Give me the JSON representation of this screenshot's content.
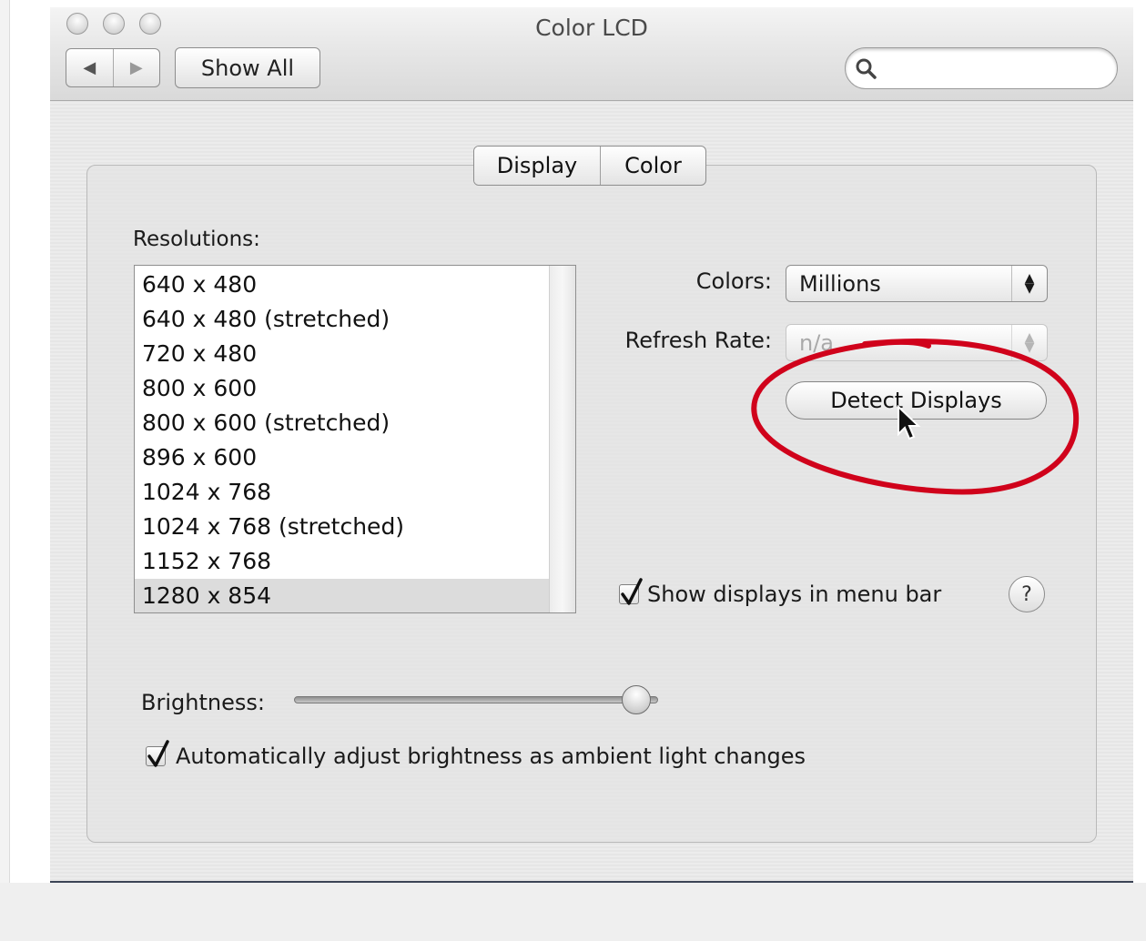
{
  "window": {
    "title": "Color LCD",
    "show_all_label": "Show All",
    "nav_back_icon": "◀",
    "nav_forward_icon": "▶",
    "search_placeholder": ""
  },
  "tabs": [
    {
      "label": "Display",
      "selected": true
    },
    {
      "label": "Color",
      "selected": false
    }
  ],
  "resolutions": {
    "label": "Resolutions:",
    "items": [
      "640 x 480",
      "640 x 480 (stretched)",
      "720 x 480",
      "800 x 600",
      "800 x 600 (stretched)",
      "896 x 600",
      "1024 x 768",
      "1024 x 768 (stretched)",
      "1152 x 768",
      "1280 x 854"
    ],
    "selected": "1280 x 854"
  },
  "colors": {
    "label": "Colors:",
    "value": "Millions"
  },
  "refresh_rate": {
    "label": "Refresh Rate:",
    "value": "n/a",
    "enabled": false
  },
  "detect_button": "Detect Displays",
  "show_displays": {
    "label": "Show displays in menu bar",
    "checked": true
  },
  "help_label": "?",
  "brightness": {
    "label": "Brightness:",
    "level": 0.94
  },
  "auto_brightness": {
    "label": "Automatically adjust brightness as ambient light changes",
    "checked": true
  },
  "annotation": {
    "color": "#d0021b"
  }
}
